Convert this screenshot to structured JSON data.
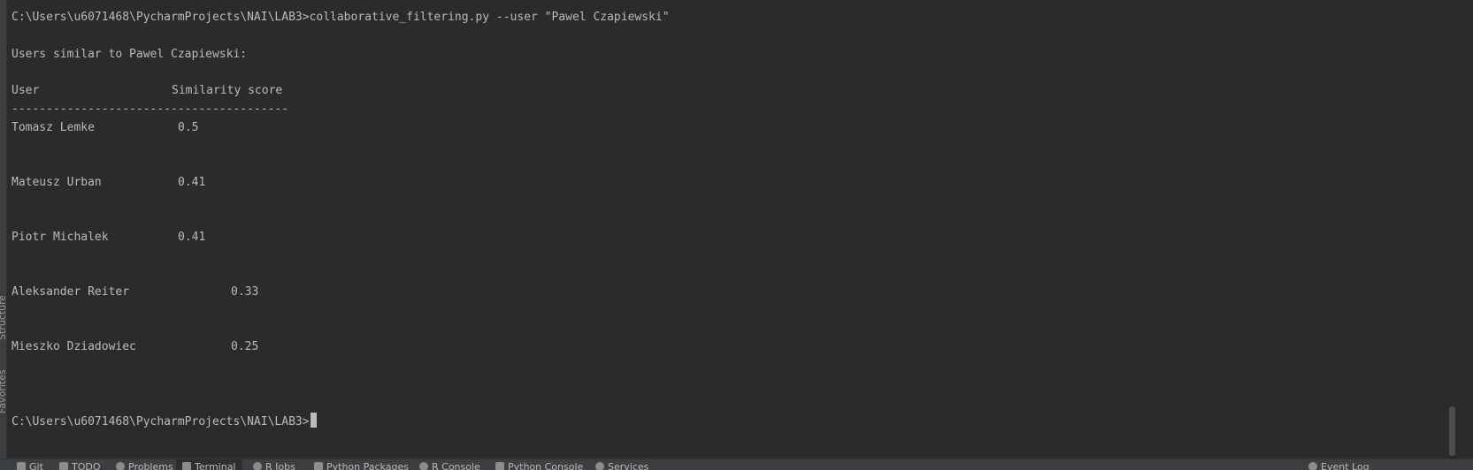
{
  "side_tabs": {
    "structure": "Structure",
    "favorites": "Favorites"
  },
  "terminal": {
    "command_line": "C:\\Users\\u6071468\\PycharmProjects\\NAI\\LAB3>collaborative_filtering.py --user \"Pawel Czapiewski\"",
    "heading": "Users similar to Pawel Czapiewski:",
    "table": {
      "columns": [
        "User",
        "Similarity score"
      ],
      "separator": "----------------------------------------",
      "rows": [
        {
          "user": "Tomasz Lemke",
          "score": "0.5"
        },
        {
          "user": "Mateusz Urban",
          "score": "0.41"
        },
        {
          "user": "Piotr Michalek",
          "score": "0.41"
        },
        {
          "user": "Aleksander Reiter",
          "score": "0.33"
        },
        {
          "user": "Mieszko Dziadowiec",
          "score": "0.25"
        }
      ]
    },
    "prompt": "C:\\Users\\u6071468\\PycharmProjects\\NAI\\LAB3>"
  },
  "tool_windows": {
    "git": "Git",
    "todo": "TODO",
    "problems": "Problems",
    "terminal": "Terminal",
    "r_jobs": "R Jobs",
    "python_packages": "Python Packages",
    "r_console": "R Console",
    "python_console": "Python Console",
    "services": "Services",
    "event_log": "Event Log"
  }
}
